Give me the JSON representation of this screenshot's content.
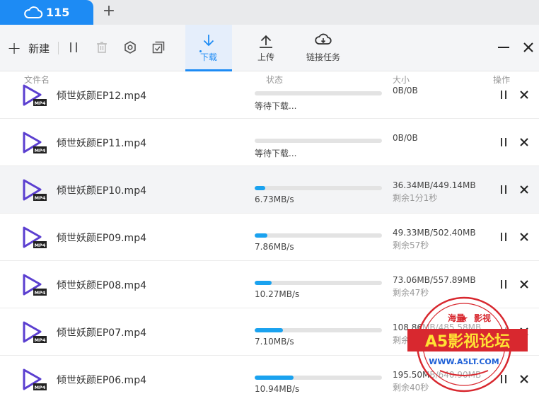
{
  "tab": {
    "title": "115",
    "icon": "cloud-icon"
  },
  "toolbar": {
    "new_label": "新建",
    "download_label": "下载",
    "upload_label": "上传",
    "link_task_label": "链接任务"
  },
  "columns": {
    "name": "文件名",
    "status": "状态",
    "size": "大小",
    "actions": "操作"
  },
  "colors": {
    "accent": "#1d8bf4",
    "progress": "#1aa2ef",
    "file_icon": "#5b3fd0",
    "stamp": "#d8282f"
  },
  "files": [
    {
      "name": "倾世妖颜EP12.mp4",
      "status": "等待下载...",
      "size": "0B/0B",
      "remain": "",
      "progress": 0
    },
    {
      "name": "倾世妖颜EP11.mp4",
      "status": "等待下载...",
      "size": "0B/0B",
      "remain": "",
      "progress": 0
    },
    {
      "name": "倾世妖颜EP10.mp4",
      "status": "6.73MB/s",
      "size": "36.34MB/449.14MB",
      "remain": "剩余1分1秒",
      "progress": 0.081
    },
    {
      "name": "倾世妖颜EP09.mp4",
      "status": "7.86MB/s",
      "size": "49.33MB/502.40MB",
      "remain": "剩余57秒",
      "progress": 0.098
    },
    {
      "name": "倾世妖颜EP08.mp4",
      "status": "10.27MB/s",
      "size": "73.06MB/557.89MB",
      "remain": "剩余47秒",
      "progress": 0.131
    },
    {
      "name": "倾世妖颜EP07.mp4",
      "status": "7.10MB/s",
      "size": "108.86MB/485.58MB",
      "remain": "剩余53秒",
      "progress": 0.224
    },
    {
      "name": "倾世妖颜EP06.mp4",
      "status": "10.94MB/s",
      "size": "195.50MB/640.90MB",
      "remain": "剩余40秒",
      "progress": 0.305
    }
  ],
  "watermark": {
    "top": "海量",
    "right": "影视",
    "main": "A5影视论坛",
    "url": "WWW.A5LT.COM"
  }
}
